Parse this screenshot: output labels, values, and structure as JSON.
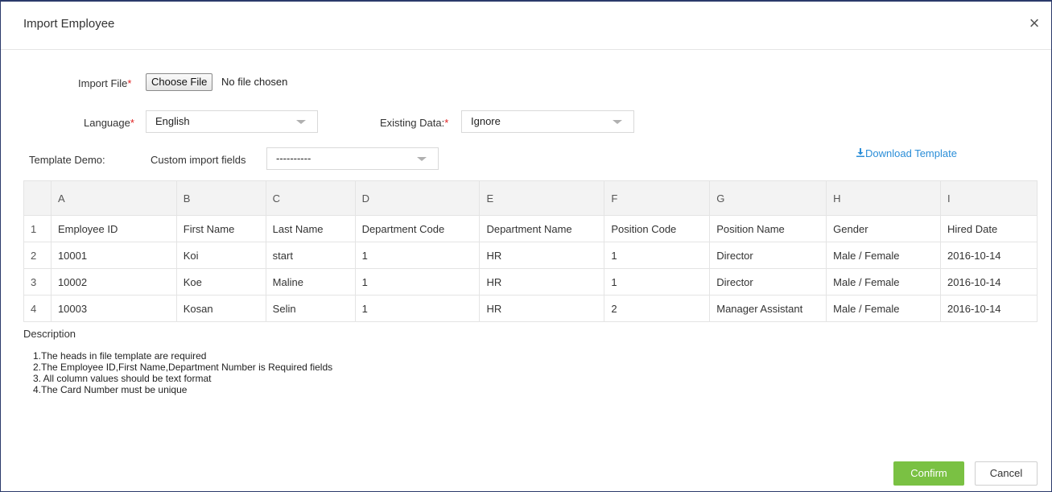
{
  "dialog": {
    "title": "Import Employee",
    "close_glyph": "×"
  },
  "form": {
    "import_file_label": "Import File",
    "required_mark": "*",
    "choose_file_label": "Choose File",
    "file_status": "No file chosen",
    "language_label": "Language",
    "language_value": "English",
    "existing_data_label": "Existing Data:",
    "existing_data_value": "Ignore",
    "template_demo_label": "Template Demo:",
    "custom_import_label": "Custom import fields",
    "custom_import_value": "----------",
    "download_template_label": "Download Template"
  },
  "table": {
    "columns": [
      "A",
      "B",
      "C",
      "D",
      "E",
      "F",
      "G",
      "H",
      "I"
    ],
    "rows": [
      {
        "idx": "1",
        "cells": [
          "Employee ID",
          "First Name",
          "Last Name",
          "Department Code",
          "Department Name",
          "Position Code",
          "Position Name",
          "Gender",
          "Hired Date"
        ]
      },
      {
        "idx": "2",
        "cells": [
          "10001",
          "Koi",
          "start",
          "1",
          "HR",
          "1",
          "Director",
          "Male / Female",
          "2016-10-14"
        ]
      },
      {
        "idx": "3",
        "cells": [
          "10002",
          "Koe",
          "Maline",
          "1",
          "HR",
          "1",
          "Director",
          "Male / Female",
          "2016-10-14"
        ]
      },
      {
        "idx": "4",
        "cells": [
          "10003",
          "Kosan",
          "Selin",
          "1",
          "HR",
          "2",
          "Manager Assistant",
          "Male / Female",
          "2016-10-14"
        ]
      }
    ]
  },
  "description": {
    "title": "Description",
    "items": [
      "1.The heads in file template are required",
      "2.The Employee ID,First Name,Department Number is Required fields",
      "3. All column values should be text format",
      "4.The Card Number must be unique"
    ]
  },
  "footer": {
    "confirm_label": "Confirm",
    "cancel_label": "Cancel"
  },
  "colors": {
    "confirm_bg": "#7ac143",
    "link": "#2b8ed8",
    "required": "#e02020"
  }
}
